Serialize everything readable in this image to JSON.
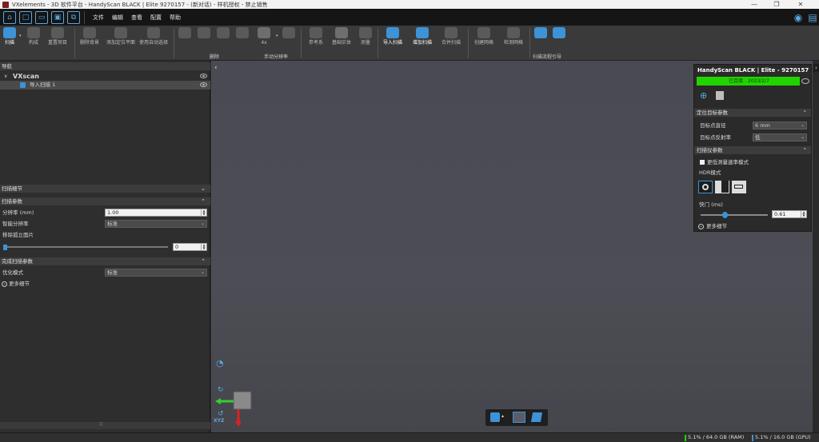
{
  "window": {
    "title": "VXelements - 3D 软件平台 - HandyScan BLACK | Elite 9270157 - (新对话) - 样机授权 - 禁止销售",
    "minimize": "—",
    "maximize": "❐",
    "close": "✕"
  },
  "menu": {
    "items": [
      "文件",
      "编辑",
      "查看",
      "配置",
      "帮助"
    ]
  },
  "ribbon": {
    "buttons": [
      {
        "label": "扫描",
        "icon": "scan-icon"
      },
      {
        "label": "构成",
        "icon": "compose-icon"
      },
      {
        "label": "重置项目",
        "icon": "reset-project-icon"
      },
      {
        "label": "删除背景",
        "icon": "delete-background-icon"
      },
      {
        "label": "添加定位平面",
        "icon": "add-plane-icon"
      },
      {
        "label": "使用自动选择",
        "icon": "auto-select-icon"
      },
      {
        "label": "",
        "icon": "select-tool-1-icon"
      },
      {
        "label": "",
        "icon": "select-tool-2-icon"
      },
      {
        "label": "",
        "icon": "select-tool-3-icon"
      },
      {
        "label": "",
        "icon": "select-tool-4-icon"
      },
      {
        "label": "4x",
        "icon": "resolution-icon"
      },
      {
        "label": "",
        "icon": "resolution-2-icon"
      },
      {
        "label": "参考系",
        "icon": "reference-icon"
      },
      {
        "label": "基础实体",
        "icon": "entities-icon"
      },
      {
        "label": "测量",
        "icon": "measure-icon"
      },
      {
        "label": "导入扫描",
        "icon": "import-scan-icon"
      },
      {
        "label": "增加扫描",
        "icon": "add-scan-icon"
      },
      {
        "label": "合并扫描",
        "icon": "merge-scan-icon"
      },
      {
        "label": "创建网格",
        "icon": "create-mesh-icon"
      },
      {
        "label": "检测网格",
        "icon": "check-mesh-icon"
      },
      {
        "label": "",
        "icon": "wizard-1-icon"
      },
      {
        "label": "",
        "icon": "wizard-2-icon"
      }
    ],
    "groups": {
      "delete": "删除",
      "manual_resolution": "手动分辨率",
      "scan_wizard": "扫描流程引导"
    }
  },
  "navigation": {
    "header": "导航",
    "root": "VXscan",
    "child": "导入扫描 1"
  },
  "scan_details": {
    "header": "扫描细节"
  },
  "scan_params": {
    "header": "扫描参数",
    "resolution_label": "分辨率 (mm)",
    "resolution_value": "1.00",
    "smart_resolution_label": "智能分辨率",
    "smart_resolution_value": "标准",
    "remove_isolated_label": "移除孤立面片",
    "remove_isolated_value": "0"
  },
  "finish_params": {
    "header": "完成扫描参数",
    "optimize_label": "优化模式",
    "optimize_value": "标准",
    "more_details": "更多细节"
  },
  "scanner_panel": {
    "title": "HandyScan BLACK | Elite - 9270157",
    "status_left": "已连接",
    "status_right": "2023/2/7",
    "positioning_header": "定位目标参数",
    "target_diameter_label": "目标点直径",
    "target_diameter_value": "6 mm",
    "target_reflect_label": "目标点反射率",
    "target_reflect_value": "低",
    "scanner_params_header": "扫描仪参数",
    "checkbox_label": "更低测量速率模式",
    "hdr_label": "HDR模式",
    "shutter_label": "快门 (ms)",
    "shutter_value": "0.61",
    "shutter_level": 0.35,
    "more_details": "更多细节"
  },
  "status": {
    "ram": "5.1% / 64.0 GB (RAM)",
    "gpu": "5.1% / 16.0 GB (GPU)"
  },
  "axes": {
    "label": "XYZ"
  },
  "colors": {
    "accent": "#3d93d6",
    "status_green": "#21d400",
    "viewport": "#4b4b53"
  }
}
